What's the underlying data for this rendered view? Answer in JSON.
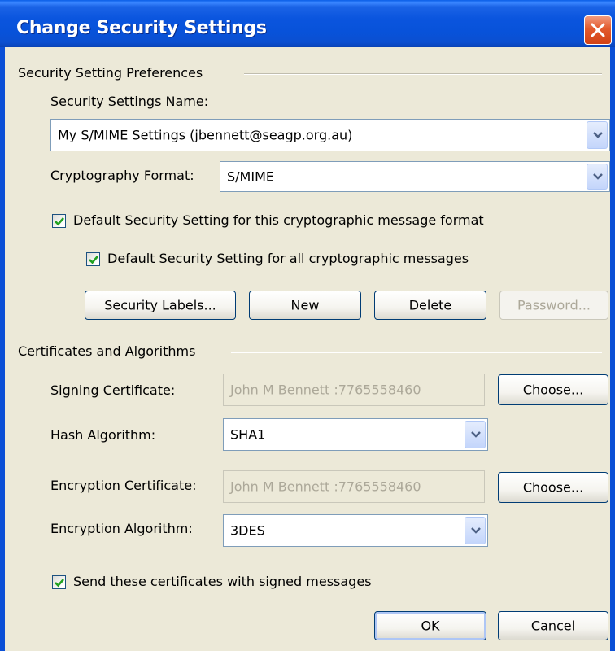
{
  "window": {
    "title": "Change Security Settings"
  },
  "preferences": {
    "group_label": "Security Setting Preferences",
    "name_label": "Security Settings Name:",
    "name_value": "My S/MIME Settings (jbennett@seagp.org.au)",
    "format_label": "Cryptography Format:",
    "format_value": "S/MIME",
    "default_format_label": "Default Security Setting for this cryptographic message format",
    "default_format_checked": true,
    "default_all_label": "Default Security Setting for all cryptographic messages",
    "default_all_checked": true,
    "buttons": {
      "security_labels": "Security Labels...",
      "new": "New",
      "delete": "Delete",
      "password": "Password..."
    }
  },
  "certificates": {
    "group_label": "Certificates and Algorithms",
    "signing_label": "Signing Certificate:",
    "signing_value": "John M Bennett :7765558460",
    "hash_label": "Hash Algorithm:",
    "hash_value": "SHA1",
    "encryption_label": "Encryption Certificate:",
    "encryption_value": "John M Bennett :7765558460",
    "enc_alg_label": "Encryption Algorithm:",
    "enc_alg_value": "3DES",
    "choose_label": "Choose...",
    "send_certs_label": "Send these certificates with signed messages",
    "send_certs_checked": true
  },
  "footer": {
    "ok": "OK",
    "cancel": "Cancel"
  },
  "icons": {
    "close": "close-icon",
    "dropdown": "chevron-down-icon",
    "check": "check-icon"
  },
  "colors": {
    "titlebar": "#0a55de",
    "dialog_bg": "#ece9d8",
    "close_button": "#e25a2d",
    "checkmark": "#21a121"
  }
}
